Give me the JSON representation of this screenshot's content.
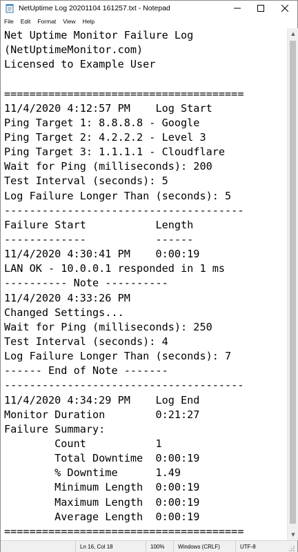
{
  "window": {
    "title": "NetUptime Log 20201104 161257.txt - Notepad",
    "controls": {
      "minimize": "—",
      "maximize": "☐",
      "close": "✕"
    }
  },
  "menu": {
    "items": [
      "File",
      "Edit",
      "Format",
      "View",
      "Help"
    ]
  },
  "editor": {
    "lines": [
      "Net Uptime Monitor Failure Log",
      "(NetUptimeMonitor.com)",
      "Licensed to Example User",
      "",
      "======================================",
      "11/4/2020 4:12:57 PM    Log Start",
      "Ping Target 1: 8.8.8.8 - Google",
      "Ping Target 2: 4.2.2.2 - Level 3",
      "Ping Target 3: 1.1.1.1 - Cloudflare",
      "Wait for Ping (milliseconds): 200",
      "Test Interval (seconds): 5",
      "Log Failure Longer Than (seconds): 5",
      "--------------------------------------",
      "Failure Start           Length",
      "-------------           ------",
      "11/4/2020 4:30:41 PM    0:00:19",
      "LAN OK - 10.0.0.1 responded in 1 ms",
      "---------- Note ----------",
      "11/4/2020 4:33:26 PM",
      "Changed Settings...",
      "Wait for Ping (milliseconds): 250",
      "Test Interval (seconds): 4",
      "Log Failure Longer Than (seconds): 7",
      "------ End of Note -------",
      "--------------------------------------",
      "11/4/2020 4:34:29 PM    Log End",
      "Monitor Duration        0:21:27",
      "Failure Summary:",
      "        Count           1",
      "        Total Downtime  0:00:19",
      "        % Downtime      1.49",
      "        Minimum Length  0:00:19",
      "        Maximum Length  0:00:19",
      "        Average Length  0:00:19",
      "======================================"
    ]
  },
  "status": {
    "position": "Ln 16, Col 18",
    "zoom": "100%",
    "line_endings": "Windows (CRLF)",
    "encoding": "UTF-8"
  },
  "icons": {
    "app": "notepad-icon",
    "scroll_up": "scroll-up-arrow-icon",
    "scroll_down": "scroll-down-arrow-icon",
    "grip": "resize-grip-icon"
  }
}
